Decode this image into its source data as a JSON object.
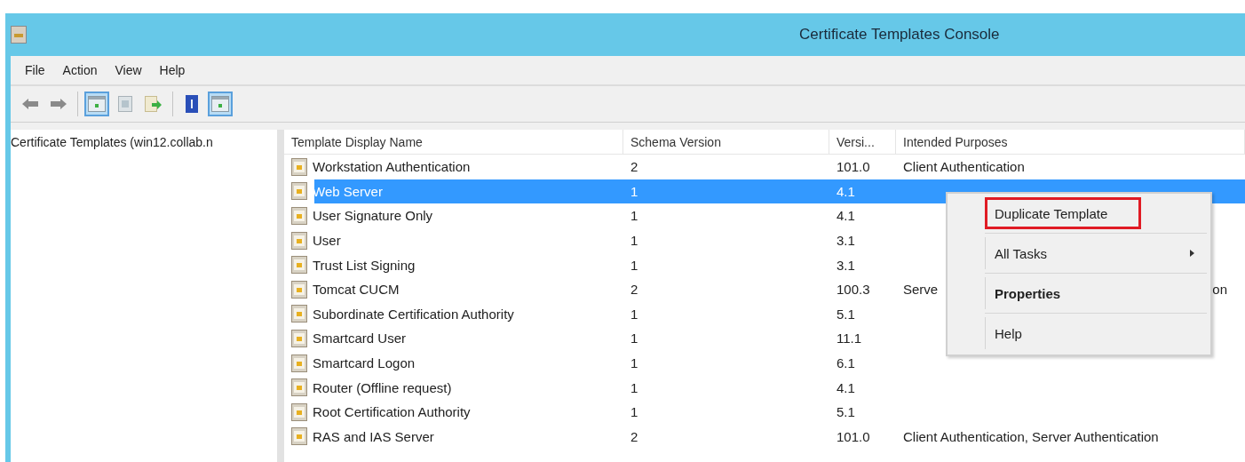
{
  "window": {
    "title": "Certificate Templates Console"
  },
  "menu_bar": [
    "File",
    "Action",
    "View",
    "Help"
  ],
  "toolbar": [
    {
      "kind": "back",
      "pressed": false
    },
    {
      "kind": "forward",
      "pressed": false
    },
    {
      "kind": "separator"
    },
    {
      "kind": "tree",
      "pressed": true
    },
    {
      "kind": "properties",
      "pressed": false
    },
    {
      "kind": "export",
      "pressed": false
    },
    {
      "kind": "separator"
    },
    {
      "kind": "help",
      "pressed": false
    },
    {
      "kind": "pane",
      "pressed": true
    }
  ],
  "tree": {
    "root": "Certificate Templates (win12.collab.n"
  },
  "table": {
    "columns": [
      "Template Display Name",
      "Schema Version",
      "Versi...",
      "Intended Purposes"
    ],
    "rows": [
      {
        "name": "Workstation Authentication",
        "schema": "2",
        "version": "101.0",
        "purposes": "Client Authentication",
        "selected": false
      },
      {
        "name": "Web Server",
        "schema": "1",
        "version": "4.1",
        "selected": true
      },
      {
        "name": "User Signature Only",
        "schema": "1",
        "version": "4.1",
        "selected": false
      },
      {
        "name": "User",
        "schema": "1",
        "version": "3.1",
        "selected": false
      },
      {
        "name": "Trust List Signing",
        "schema": "1",
        "version": "3.1",
        "selected": false
      },
      {
        "name": "Tomcat CUCM",
        "schema": "2",
        "version": "100.3",
        "purposes": "Serve",
        "purposes_end": "on",
        "selected": false
      },
      {
        "name": "Subordinate Certification Authority",
        "schema": "1",
        "version": "5.1",
        "selected": false
      },
      {
        "name": "Smartcard User",
        "schema": "1",
        "version": "11.1",
        "selected": false
      },
      {
        "name": "Smartcard Logon",
        "schema": "1",
        "version": "6.1",
        "selected": false
      },
      {
        "name": "Router (Offline request)",
        "schema": "1",
        "version": "4.1",
        "selected": false
      },
      {
        "name": "Root Certification Authority",
        "schema": "1",
        "version": "5.1",
        "selected": false
      },
      {
        "name": "RAS and IAS Server",
        "schema": "2",
        "version": "101.0",
        "purposes": "Client Authentication, Server Authentication",
        "selected": false
      }
    ]
  },
  "context_menu": [
    {
      "label": "Duplicate Template",
      "kind": "item",
      "highlighted": true,
      "bold": false
    },
    {
      "label": "All Tasks",
      "kind": "submenu",
      "highlighted": false,
      "bold": false
    },
    {
      "label": "Properties",
      "kind": "item",
      "highlighted": false,
      "bold": true
    },
    {
      "label": "Help",
      "kind": "item",
      "highlighted": false,
      "bold": false
    }
  ]
}
